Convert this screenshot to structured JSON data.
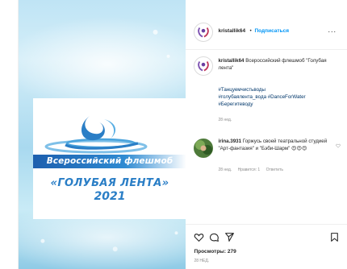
{
  "post": {
    "media": {
      "flash_text": "Всероссийский флешмоб",
      "title": "«ГОЛУБАЯ ЛЕНТА»",
      "year": "2021"
    },
    "header": {
      "username": "kristallik64",
      "separator": "•",
      "follow_label": "Подписаться",
      "more_label": "..."
    },
    "caption": {
      "username": "kristallik64",
      "text": "Всероссийский флешмоб \"Голубая лента\"",
      "hashtags_line1": "#Танцуемчистьводы",
      "hashtags_line2": "#голубаялента_вода #DanceForWater",
      "hashtags_line3": "#Берегитеводу",
      "time": "28 нед."
    },
    "comment": {
      "username": "irina.3931",
      "text": "Горжусь своей театральной студией \"Арт-фантазия\" и \"Бэби-Шарм\"",
      "emojis": "😍😍😍",
      "time": "28 нед.",
      "likes": "Нравится: 1",
      "reply_label": "Ответить"
    },
    "actions": {
      "views": "Просмотры: 279",
      "date": "28 НЕД."
    },
    "colors": {
      "link": "#0095f6",
      "hashtag": "#00376b",
      "muted": "#8e8e8e",
      "brand_blue": "#2a7ec6"
    }
  }
}
